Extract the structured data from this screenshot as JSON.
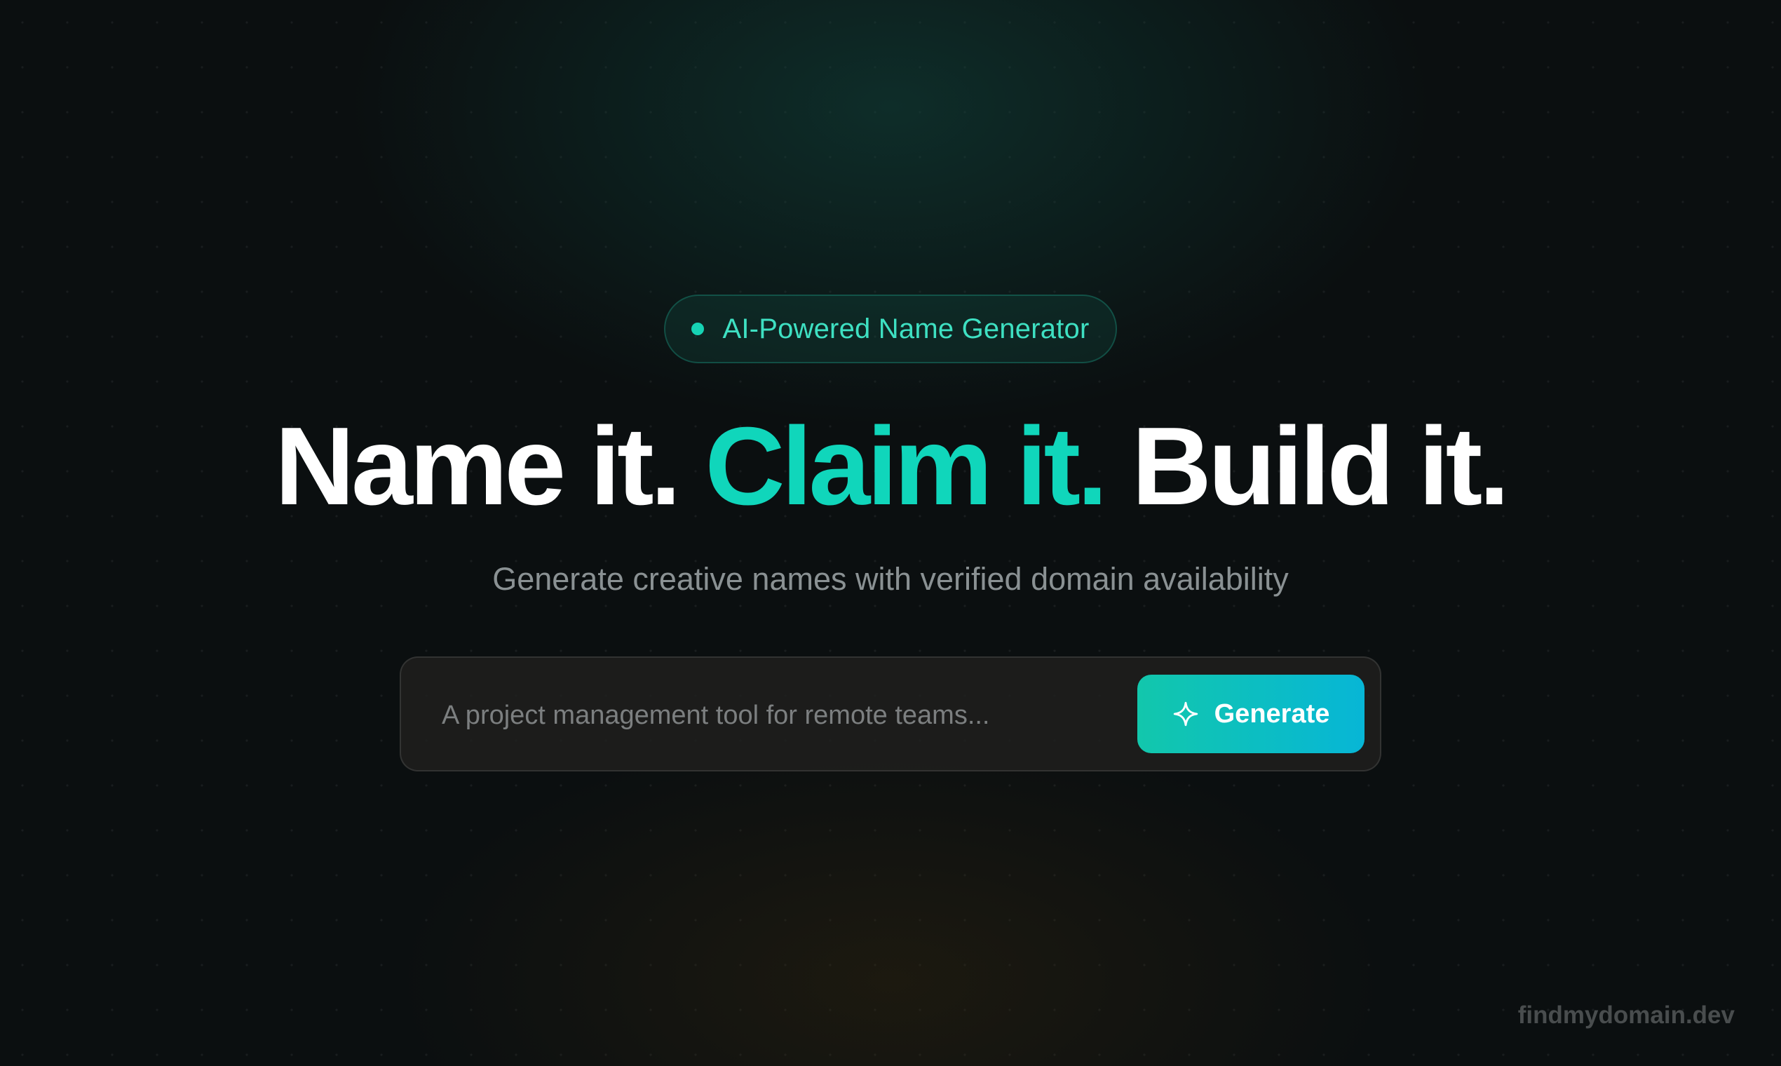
{
  "badge": {
    "label": "AI-Powered Name Generator"
  },
  "headline": {
    "part1": "Name it.",
    "part2": "Claim it.",
    "part3": "Build it."
  },
  "subtitle": "Generate creative names with verified domain availability",
  "search": {
    "placeholder": "A project management tool for remote teams...",
    "value": ""
  },
  "generate_button": {
    "label": "Generate",
    "icon": "sparkle-icon"
  },
  "footer": {
    "domain": "findmydomain.dev"
  },
  "colors": {
    "accent": "#10d6bb",
    "button_gradient_start": "#12c7ac",
    "button_gradient_end": "#07b6d6",
    "background": "#0b0f10"
  }
}
